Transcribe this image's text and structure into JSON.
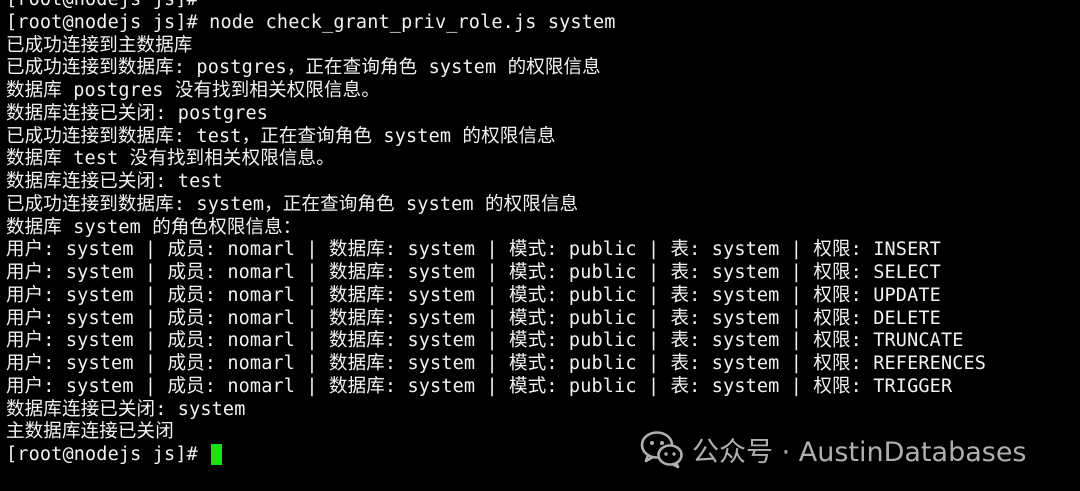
{
  "terminal": {
    "lines": [
      "[root@nodejs js]#",
      "[root@nodejs js]# node check_grant_priv_role.js system",
      "已成功连接到主数据库",
      "已成功连接到数据库: postgres，正在查询角色 system 的权限信息",
      "数据库 postgres 没有找到相关权限信息。",
      "数据库连接已关闭: postgres",
      "已成功连接到数据库: test，正在查询角色 system 的权限信息",
      "数据库 test 没有找到相关权限信息。",
      "数据库连接已关闭: test",
      "已成功连接到数据库: system，正在查询角色 system 的权限信息",
      "数据库 system 的角色权限信息：",
      "用户: system | 成员: nomarl | 数据库: system | 模式: public | 表: system | 权限: INSERT",
      "用户: system | 成员: nomarl | 数据库: system | 模式: public | 表: system | 权限: SELECT",
      "用户: system | 成员: nomarl | 数据库: system | 模式: public | 表: system | 权限: UPDATE",
      "用户: system | 成员: nomarl | 数据库: system | 模式: public | 表: system | 权限: DELETE",
      "用户: system | 成员: nomarl | 数据库: system | 模式: public | 表: system | 权限: TRUNCATE",
      "用户: system | 成员: nomarl | 数据库: system | 模式: public | 表: system | 权限: REFERENCES",
      "用户: system | 成员: nomarl | 数据库: system | 模式: public | 表: system | 权限: TRIGGER",
      "数据库连接已关闭: system",
      "主数据库连接已关闭"
    ],
    "prompt": "[root@nodejs js]# ",
    "cursor_color": "#19e019",
    "text_color": "#f2f2f2",
    "background": "#000000"
  },
  "watermark": {
    "icon": "wechat-icon",
    "text": "公众号 · AustinDatabases"
  }
}
